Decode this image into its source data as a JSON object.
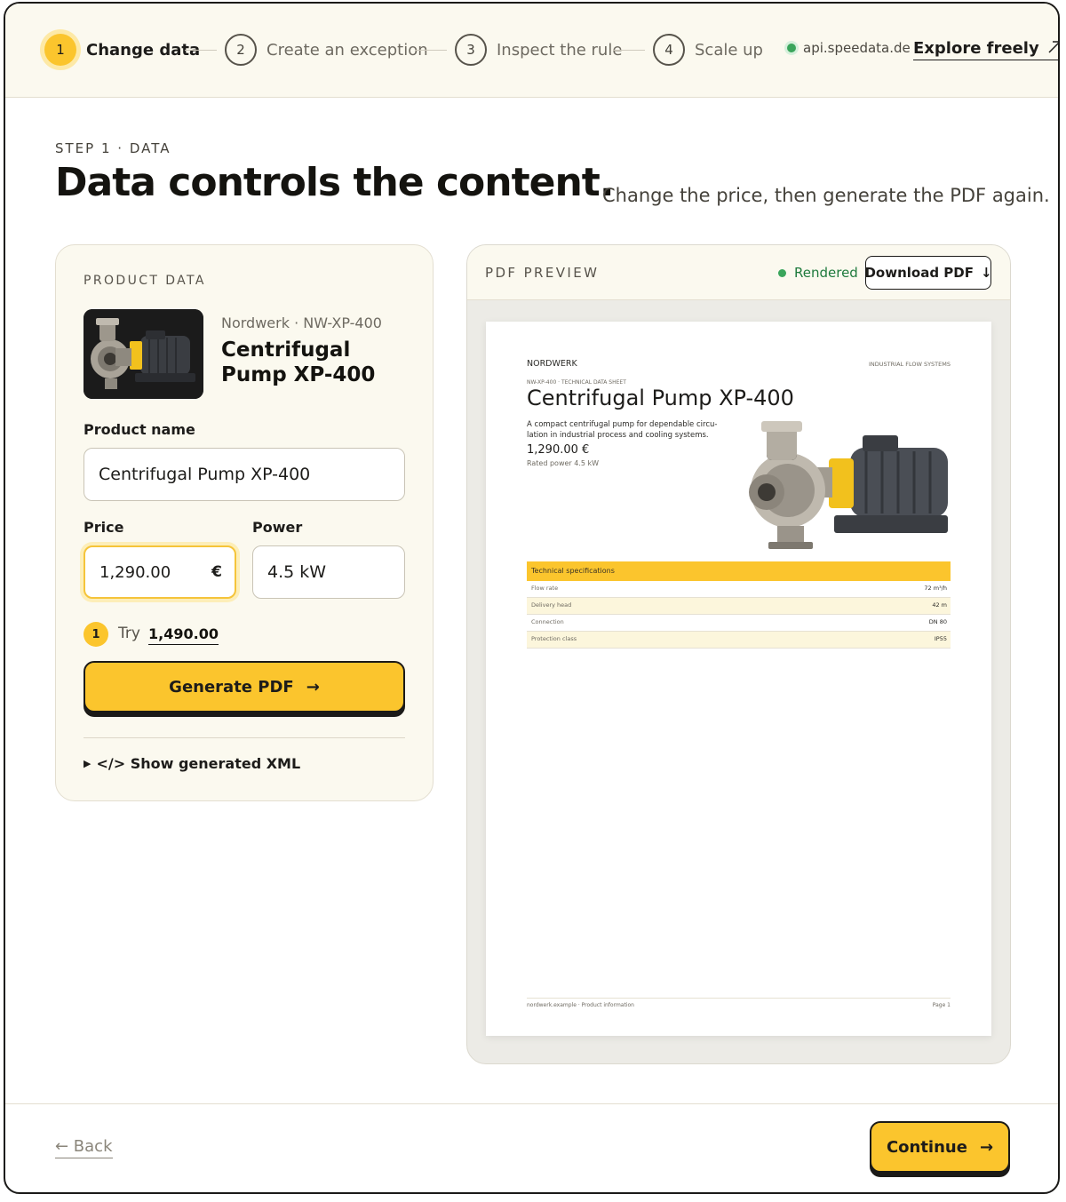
{
  "stepper": {
    "steps": [
      {
        "number": "1",
        "label": "Change data"
      },
      {
        "number": "2",
        "label": "Create an exception"
      },
      {
        "number": "3",
        "label": "Inspect the rule"
      },
      {
        "number": "4",
        "label": "Scale up"
      }
    ],
    "active_step": 1,
    "api_host": "api.speedata.de",
    "explore_label": "Explore freely",
    "explore_icon": "external-arrow-icon"
  },
  "header": {
    "eyebrow": "STEP 1 · DATA",
    "title": "Data controls the content.",
    "subtitle": "Change the price, then generate the PDF again."
  },
  "product_data": {
    "section_label": "PRODUCT DATA",
    "brand_line": "Nordwerk · NW-XP-400",
    "product_title": "Centrifugal Pump XP-400",
    "name_label": "Product name",
    "name_value": "Centrifugal Pump XP-400",
    "price_label": "Price",
    "price_value": "1,290.00",
    "currency": "€",
    "power_label": "Power",
    "power_value": "4.5 kW",
    "try_badge": "1",
    "try_text": "Try",
    "try_value": "1,490.00",
    "generate_label": "Generate PDF",
    "generate_icon": "arrow-right-icon",
    "xml_toggle_label": "</> Show generated XML"
  },
  "preview": {
    "section_label": "PDF PREVIEW",
    "status": "Rendered",
    "download_label": "Download PDF",
    "download_icon": "arrow-down-icon",
    "pdf": {
      "brand": "NORDWERK",
      "category": "INDUSTRIAL FLOW SYSTEMS",
      "doc_kind": "NW-XP-400 · TECHNICAL DATA SHEET",
      "title": "Centrifugal Pump XP-400",
      "description_1": "A compact centrifugal pump for dependable circu-",
      "description_2": "lation in industrial process and cooling systems.",
      "price": "1,290.00 €",
      "rated_power_label": "Rated power",
      "rated_power_value": "4.5 kW",
      "spec_heading": "Technical specifications",
      "specs": [
        {
          "key": "Flow rate",
          "value": "72 m³/h"
        },
        {
          "key": "Delivery head",
          "value": "42 m"
        },
        {
          "key": "Connection",
          "value": "DN 80"
        },
        {
          "key": "Protection class",
          "value": "IP55"
        }
      ],
      "footer_left": "nordwerk.example · Product information",
      "footer_right": "Page 1"
    }
  },
  "footer": {
    "back_label": "← Back",
    "continue_label": "Continue",
    "continue_icon": "arrow-right-icon"
  },
  "colors": {
    "accent": "#fbc52d",
    "panel": "#fbf9ef",
    "ink": "#1b1a18",
    "success": "#3aa55b"
  }
}
